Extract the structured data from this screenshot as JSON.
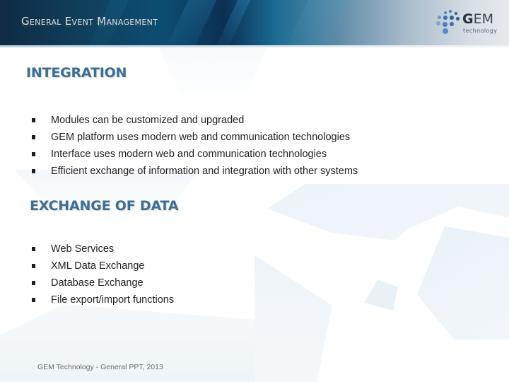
{
  "header": {
    "title": "General Event Management",
    "logo": {
      "brand_bold": "G",
      "brand_rest": "EM",
      "subtitle": "technology",
      "icon": "dots-cluster-icon",
      "accent_color": "#3b6fa8"
    }
  },
  "sections": [
    {
      "title": "INTEGRATION",
      "bullets": [
        "Modules can be customized and upgraded",
        "GEM platform uses modern web and communication technologies",
        "Interface uses modern web and communication technologies",
        "Efficient exchange of information and integration with other systems"
      ]
    },
    {
      "title": "EXCHANGE OF DATA",
      "bullets": [
        "Web Services",
        "XML Data Exchange",
        "Database Exchange",
        "File export/import functions"
      ]
    }
  ],
  "footer": {
    "text": "GEM Technology - General PPT, 2013"
  },
  "colors": {
    "heading": "#3d6e95",
    "body_text": "#1f1f1f",
    "footer_text": "#6b6b6b"
  }
}
